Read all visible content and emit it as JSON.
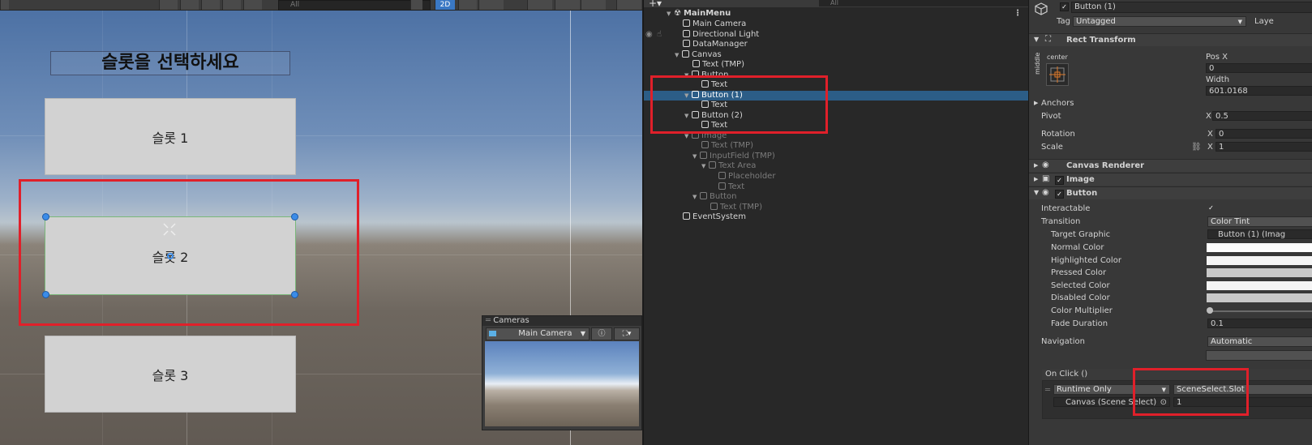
{
  "scene": {
    "search_placeholder": "All",
    "mode_2d": "2D",
    "title_text": "슬롯을 선택하세요",
    "slots": [
      "슬롯 1",
      "슬롯 2",
      "슬롯 3"
    ],
    "camera_panel": {
      "title": "Cameras",
      "selected_camera": "Main Camera"
    }
  },
  "hierarchy": {
    "search_placeholder": "All",
    "items": [
      {
        "label": "MainMenu",
        "depth": 0,
        "bold": true
      },
      {
        "label": "Main Camera",
        "depth": 1
      },
      {
        "label": "Directional Light",
        "depth": 1
      },
      {
        "label": "DataManager",
        "depth": 1
      },
      {
        "label": "Canvas",
        "depth": 1,
        "expanded": true
      },
      {
        "label": "Text (TMP)",
        "depth": 2
      },
      {
        "label": "Button",
        "depth": 2,
        "expanded": true
      },
      {
        "label": "Text",
        "depth": 3
      },
      {
        "label": "Button (1)",
        "depth": 2,
        "expanded": true,
        "selected": true
      },
      {
        "label": "Text",
        "depth": 3
      },
      {
        "label": "Button (2)",
        "depth": 2,
        "expanded": true
      },
      {
        "label": "Text",
        "depth": 3
      },
      {
        "label": "Image",
        "depth": 2,
        "dim": true,
        "expanded": true
      },
      {
        "label": "Text (TMP)",
        "depth": 3,
        "dim": true
      },
      {
        "label": "InputField (TMP)",
        "depth": 3,
        "dim": true,
        "expanded": true
      },
      {
        "label": "Text Area",
        "depth": 4,
        "dim": true,
        "expanded": true
      },
      {
        "label": "Placeholder",
        "depth": 5,
        "dim": true
      },
      {
        "label": "Text",
        "depth": 5,
        "dim": true
      },
      {
        "label": "Button",
        "depth": 3,
        "dim": true,
        "expanded": true
      },
      {
        "label": "Text (TMP)",
        "depth": 4,
        "dim": true
      },
      {
        "label": "EventSystem",
        "depth": 1
      }
    ]
  },
  "inspector": {
    "object_name": "Button (1)",
    "tag_label": "Tag",
    "tag_value": "Untagged",
    "layer_label": "Laye",
    "rect_transform": {
      "header": "Rect Transform",
      "anchor_preset_h": "center",
      "anchor_preset_v": "middle",
      "pos_x_label": "Pos X",
      "pos_x_value": "0",
      "width_label": "Width",
      "width_value": "601.0168",
      "anchors_label": "Anchors",
      "pivot_label": "Pivot",
      "pivot_x": "0.5",
      "rotation_label": "Rotation",
      "rotation_x": "0",
      "scale_label": "Scale",
      "scale_x": "1",
      "x_label": "X"
    },
    "components": {
      "canvas_renderer": "Canvas Renderer",
      "image": "Image",
      "button": "Button"
    },
    "button": {
      "interactable_label": "Interactable",
      "transition_label": "Transition",
      "transition_value": "Color Tint",
      "target_graphic_label": "Target Graphic",
      "target_graphic_value": "Button (1) (Imag",
      "normal_color_label": "Normal Color",
      "highlighted_color_label": "Highlighted Color",
      "pressed_color_label": "Pressed Color",
      "selected_color_label": "Selected Color",
      "disabled_color_label": "Disabled Color",
      "color_multiplier_label": "Color Multiplier",
      "fade_duration_label": "Fade Duration",
      "fade_duration_value": "0.1",
      "navigation_label": "Navigation",
      "navigation_value": "Automatic",
      "colors": {
        "normal": "#ffffff",
        "highlighted": "#f5f5f5",
        "pressed": "#c8c8c8",
        "selected": "#f5f5f5",
        "disabled": "#c8c8c8"
      }
    },
    "on_click": {
      "header": "On Click ()",
      "runtime_value": "Runtime Only",
      "function_value": "SceneSelect.Slot",
      "target_value": "Canvas (Scene Select)",
      "argument_value": "1"
    }
  }
}
